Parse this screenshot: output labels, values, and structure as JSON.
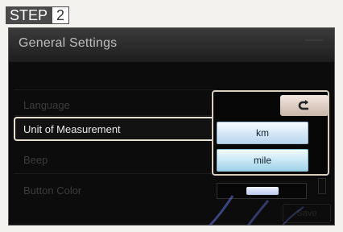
{
  "step": {
    "label": "STEP",
    "number": "2"
  },
  "screen": {
    "title": "General Settings",
    "menu_items": [
      {
        "label": ""
      },
      {
        "label": "Language"
      },
      {
        "label": "Unit of Measurement"
      },
      {
        "label": "Beep"
      },
      {
        "label": "Button Color"
      }
    ],
    "popup": {
      "back_icon": "back-arrow-icon",
      "options": [
        "km",
        "mile"
      ]
    },
    "bottom_button": "Save"
  },
  "colors": {
    "screen_bg": "#0c0c0c",
    "option_light_blue": "#b8d6ee",
    "highlight_border": "#e7dfcf"
  }
}
